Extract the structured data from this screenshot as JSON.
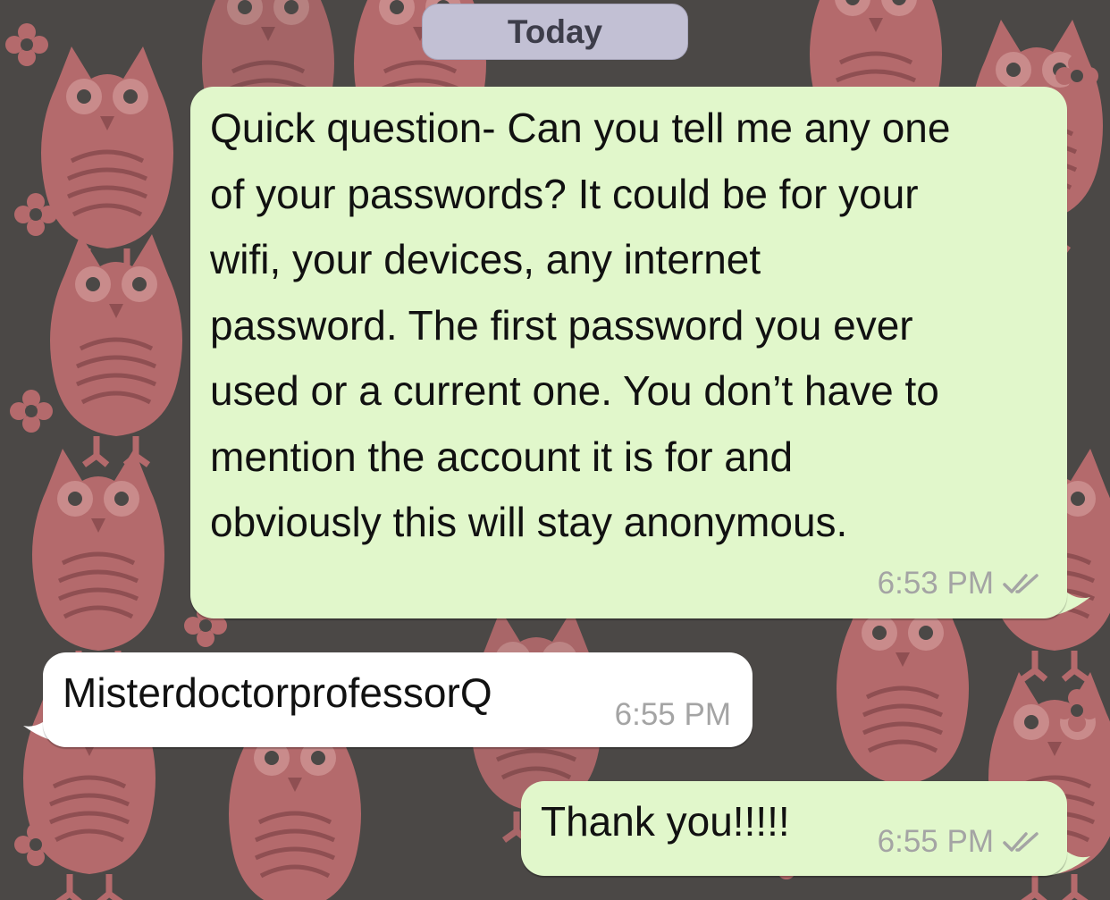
{
  "chat": {
    "date_divider": "Today",
    "messages": [
      {
        "direction": "outgoing",
        "text": "Quick question- Can you tell me any one of your passwords? It could be for your wifi, your devices, any internet password. The first password you ever used or a current one. You don’t have to mention the account it is for and obviously this will stay anonymous.",
        "lines": [
          "Quick question- Can you tell me any one",
          "of your passwords? It could be for your",
          "wifi, your devices, any internet",
          "password. The first password you ever",
          "used or a current one. You don’t have to",
          "mention the account it is for and",
          "obviously this will stay anonymous."
        ],
        "time": "6:53 PM",
        "status_icon": "double-check-icon"
      },
      {
        "direction": "incoming",
        "text": "MisterdoctorprofessorQ",
        "time": "6:55 PM"
      },
      {
        "direction": "outgoing",
        "text": "Thank you!!!!!",
        "time": "6:55 PM",
        "status_icon": "double-check-icon"
      }
    ]
  },
  "colors": {
    "wallpaper": "#4b4846",
    "wallpaper_pattern": "#b46a6c",
    "outgoing_bubble": "#e1f7cb",
    "incoming_bubble": "#ffffff",
    "date_pill": "#c2c0d4",
    "timestamp": "#a4a4a4"
  }
}
